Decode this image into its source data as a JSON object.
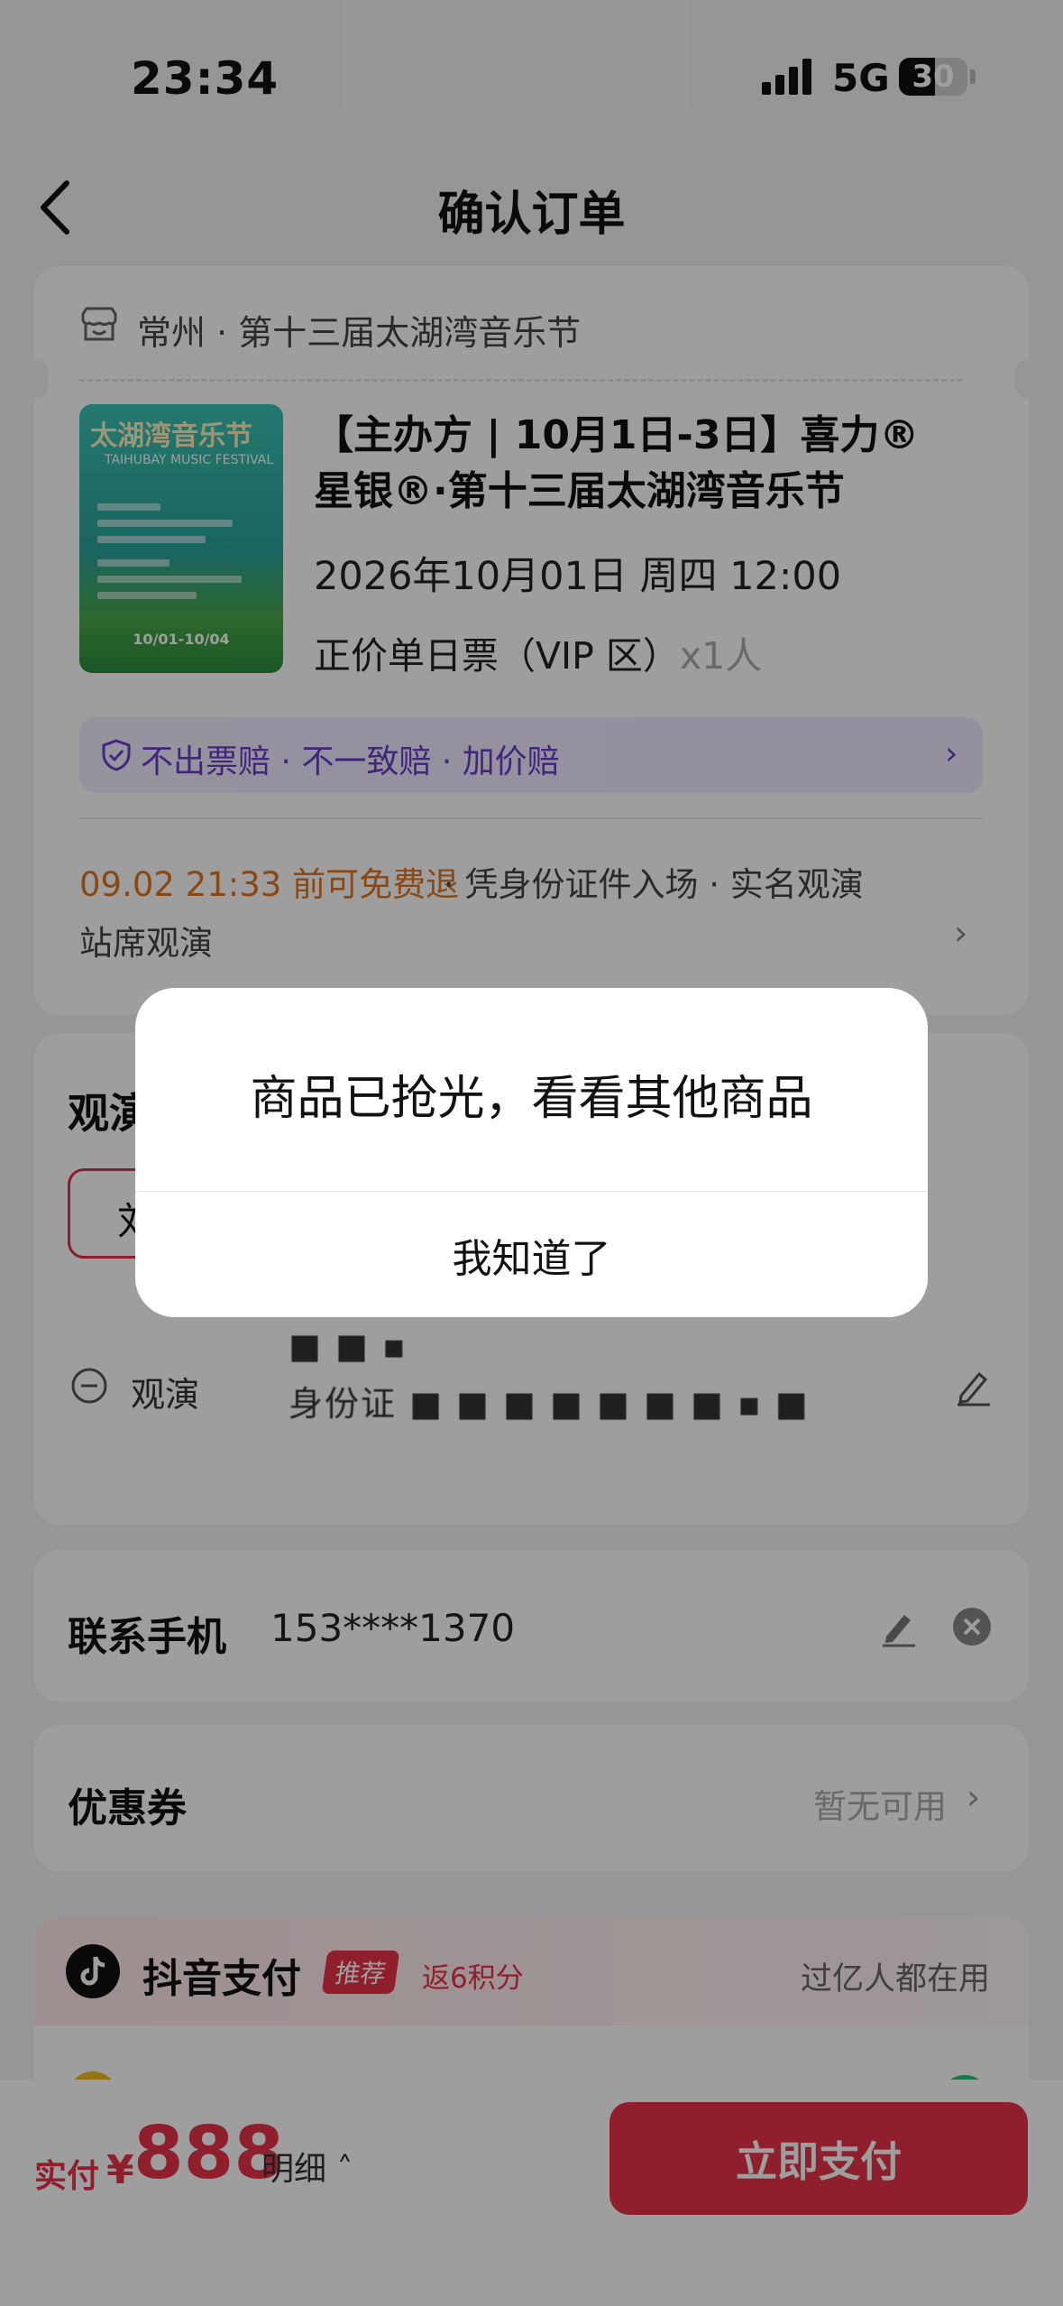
{
  "status_bar": {
    "time": "23:34",
    "network": "5G",
    "battery": "30"
  },
  "header": {
    "title": "确认订单"
  },
  "ticket": {
    "venue": "常州 · 第十三届太湖湾音乐节",
    "poster_title": "太湖湾音乐节",
    "poster_subtitle": "TAIHUBAY MUSIC FESTIVAL",
    "poster_dates": "10/01-10/04",
    "event_name": "【主办方 | 10月1日-3日】喜力®星银®·第十三届太湖湾音乐节",
    "event_datetime": "2026年10月01日 周四 12:00",
    "ticket_type": "正价单日票（VIP 区）",
    "quantity": "x1人",
    "guarantee": "不出票赔 · 不一致赔 · 加价赔",
    "refund_policy": "09.02 21:33 前可免费退",
    "entry_policy": " · 凭身份证件入场 · 实名观演",
    "seating": "站席观演"
  },
  "viewer": {
    "section_title": "观演",
    "chip_label": "刘",
    "row_label": "观演",
    "name_masked": "■ ■ ▪",
    "id_masked": "身份证 ■ ■ ■ ■ ■ ■ ■ ▪ ■"
  },
  "contact": {
    "label": "联系手机",
    "value": "153****1370"
  },
  "coupon": {
    "label": "优惠券",
    "value": "暂无可用"
  },
  "payment": {
    "method": "抖音支付",
    "tag": "推荐",
    "points": "返6积分",
    "note": "过亿人都在用"
  },
  "bottom_bar": {
    "pay_label": "实付",
    "currency": "¥",
    "amount": "888",
    "detail": "明细",
    "pay_button": "立即支付"
  },
  "dialog": {
    "message": "商品已抢光，看看其他商品",
    "confirm": "我知道了"
  },
  "colors": {
    "accent": "#e8334b",
    "guarantee": "#6a3ec9",
    "refund": "#e2741f"
  }
}
